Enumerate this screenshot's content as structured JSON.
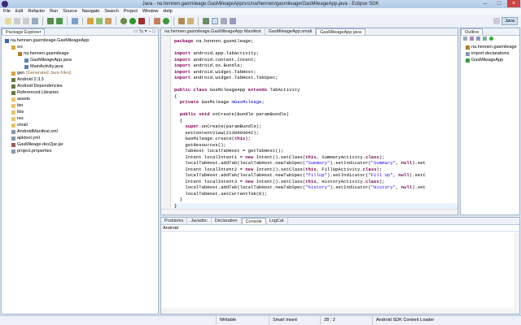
{
  "window": {
    "title": "Java - na.hennen.gasmileage.GasMileageApp/src/na/hennen/gasmileage/GasMileageApp.java - Eclipse SDK"
  },
  "menu": [
    "File",
    "Edit",
    "Refactor",
    "Run",
    "Source",
    "Navigate",
    "Search",
    "Project",
    "Window",
    "Help"
  ],
  "perspective": {
    "label": "Java"
  },
  "package_explorer": {
    "title": "Package Explorer",
    "items": [
      {
        "label": "na.hennen.gasmileage.GasMileageApp",
        "level": 0,
        "color": "#3a66b0"
      },
      {
        "label": "src",
        "level": 1,
        "color": "#d9a441"
      },
      {
        "label": "na.hennen.gasmileage",
        "level": 2,
        "color": "#b07a2a"
      },
      {
        "label": "GasMileageApp.java",
        "level": 3,
        "color": "#5a7fc0"
      },
      {
        "label": "MainActivity.java",
        "level": 3,
        "color": "#5a7fc0"
      },
      {
        "label": "gen",
        "suffix": " [Generated Java Files]",
        "level": 1,
        "color": "#d9a441"
      },
      {
        "label": "Android 2.3.3",
        "level": 1,
        "color": "#6a7a40"
      },
      {
        "label": "Android Dependencies",
        "level": 1,
        "color": "#6a7a40"
      },
      {
        "label": "Referenced Libraries",
        "level": 1,
        "color": "#6a7a40"
      },
      {
        "label": "assets",
        "level": 1,
        "color": "#e8c46a"
      },
      {
        "label": "bin",
        "level": 1,
        "color": "#e8c46a"
      },
      {
        "label": "libs",
        "level": 1,
        "color": "#e8c46a"
      },
      {
        "label": "res",
        "level": 1,
        "color": "#e8c46a"
      },
      {
        "label": "smali",
        "level": 1,
        "color": "#e8c46a"
      },
      {
        "label": "AndroidManifest.xml",
        "level": 1,
        "color": "#8899aa"
      },
      {
        "label": "apktool.yml",
        "level": 1,
        "color": "#8899aa"
      },
      {
        "label": "GasMileage-dex2jar.jar",
        "level": 1,
        "color": "#a05a5a"
      },
      {
        "label": "project.properties",
        "level": 1,
        "color": "#8899aa"
      }
    ]
  },
  "editor": {
    "tabs": [
      {
        "label": "na.hennen.gasmileage.GasMileageApp Manifest",
        "active": false
      },
      {
        "label": "GasMileageApp.smali",
        "active": false
      },
      {
        "label": "GasMileageApp.java",
        "active": true
      }
    ],
    "code": [
      "package na.hennen.gasmileage;",
      "",
      "import android.app.TabActivity;",
      "import android.content.Intent;",
      "import android.os.Bundle;",
      "import android.widget.TabHost;",
      "import android.widget.TabHost.TabSpec;",
      "",
      "public class GasMileageApp extends TabActivity",
      "{",
      "  private GasMileage mGasMileage;",
      "",
      "  public void onCreate(Bundle paramBundle)",
      "  {",
      "    super.onCreate(paramBundle);",
      "    setContentView(2130903042);",
      "    GasMileage.create(this);",
      "    getResources();",
      "    TabHost localTabHost = getTabHost();",
      "    Intent localIntent1 = new Intent().setClass(this, SummaryActivity.class);",
      "    localTabHost.addTab(localTabHost.newTabSpec(\"Summary\").setIndicator(\"Summary\", null).set",
      "    Intent localIntent2 = new Intent().setClass(this, FillUpActivity.class);",
      "    localTabHost.addTab(localTabHost.newTabSpec(\"fillup\").setIndicator(\"Fill Up\", null).setC",
      "    Intent localIntent3 = new Intent().setClass(this, HistoryActivity.class);",
      "    localTabHost.addTab(localTabHost.newTabSpec(\"history\").setIndicator(\"History\", null).set",
      "    localTabHost.setCurrentTab(0);",
      "  }",
      "}"
    ]
  },
  "outline": {
    "title": "Outline",
    "items": [
      {
        "label": "na.hennen.gasmileage",
        "color": "#b07a2a"
      },
      {
        "label": "import declarations",
        "color": "#8899aa"
      },
      {
        "label": "GasMileageApp",
        "color": "#3a9a3a"
      }
    ]
  },
  "bottom": {
    "tabs": [
      {
        "label": "Problems",
        "active": false
      },
      {
        "label": "Javadoc",
        "active": false
      },
      {
        "label": "Declaration",
        "active": false
      },
      {
        "label": "Console",
        "active": true
      },
      {
        "label": "LogCat",
        "active": false
      }
    ],
    "console_name": "Android"
  },
  "status": {
    "writable": "Writable",
    "insert_mode": "Smart Insert",
    "position": "28 : 2",
    "task": "Android SDK Content Loader"
  }
}
